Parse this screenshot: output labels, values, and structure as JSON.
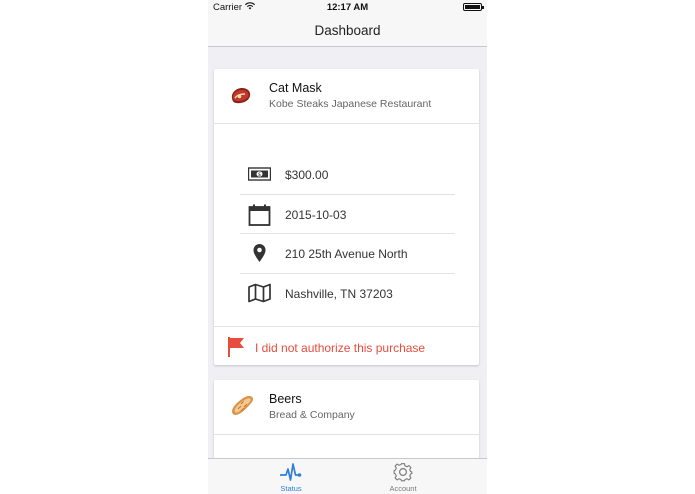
{
  "status_bar": {
    "carrier": "Carrier",
    "time": "12:17 AM"
  },
  "nav": {
    "title": "Dashboard"
  },
  "cards": [
    {
      "title": "Cat Mask",
      "subtitle": "Kobe Steaks Japanese Restaurant",
      "emoji_icon": "steak-emoji-icon",
      "details": [
        {
          "icon": "cash-icon",
          "text": "$300.00"
        },
        {
          "icon": "calendar-icon",
          "text": "2015-10-03"
        },
        {
          "icon": "location-pin-icon",
          "text": "210 25th Avenue North"
        },
        {
          "icon": "map-icon",
          "text": "Nashville, TN 37203"
        }
      ],
      "flag_label": "I did not authorize this purchase"
    },
    {
      "title": "Beers",
      "subtitle": "Bread & Company",
      "emoji_icon": "bread-emoji-icon"
    }
  ],
  "tabs": [
    {
      "label": "Status",
      "icon": "pulse-icon",
      "active": true
    },
    {
      "label": "Account",
      "icon": "gear-icon",
      "active": false
    }
  ],
  "colors": {
    "accent": "#2f7fd6",
    "alert": "#e74c3c",
    "background": "#efeff4"
  }
}
